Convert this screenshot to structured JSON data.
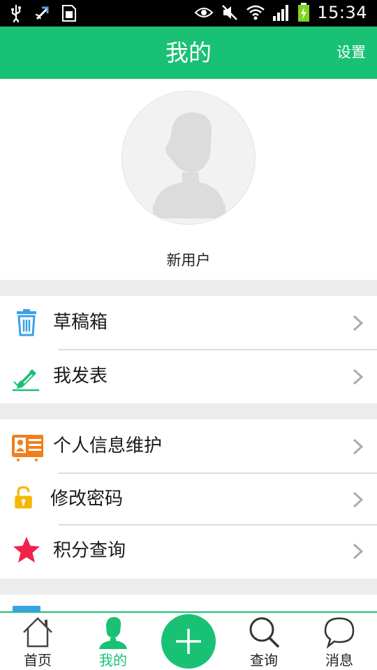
{
  "status_bar": {
    "time": "15:34",
    "left_icons": [
      "usb-icon",
      "cast-icon",
      "sim-card-icon"
    ],
    "right_icons": [
      "eye-icon",
      "mute-icon",
      "wifi-icon",
      "signal-icon",
      "battery-charging-icon"
    ]
  },
  "header": {
    "title": "我的",
    "settings_label": "设置"
  },
  "profile": {
    "username": "新用户"
  },
  "menu": {
    "group1": [
      {
        "label": "草稿箱",
        "icon": "trash-icon"
      },
      {
        "label": "我发表",
        "icon": "pencil-icon"
      }
    ],
    "group2": [
      {
        "label": "个人信息维护",
        "icon": "id-card-icon"
      },
      {
        "label": "修改密码",
        "icon": "unlock-icon"
      },
      {
        "label": "积分查询",
        "icon": "star-icon"
      }
    ]
  },
  "bottom_nav": {
    "items": [
      {
        "label": "首页",
        "icon": "home-icon"
      },
      {
        "label": "我的",
        "icon": "user-icon",
        "active": true
      },
      {
        "label": "",
        "icon": "plus-icon"
      },
      {
        "label": "查询",
        "icon": "search-icon"
      },
      {
        "label": "消息",
        "icon": "chat-bubble-icon"
      }
    ]
  },
  "colors": {
    "brand_green": "#18c174",
    "trash_blue": "#3aa0e8",
    "id_orange": "#f07f1c",
    "lock_yellow": "#f5b800",
    "star_red": "#f2234a"
  }
}
